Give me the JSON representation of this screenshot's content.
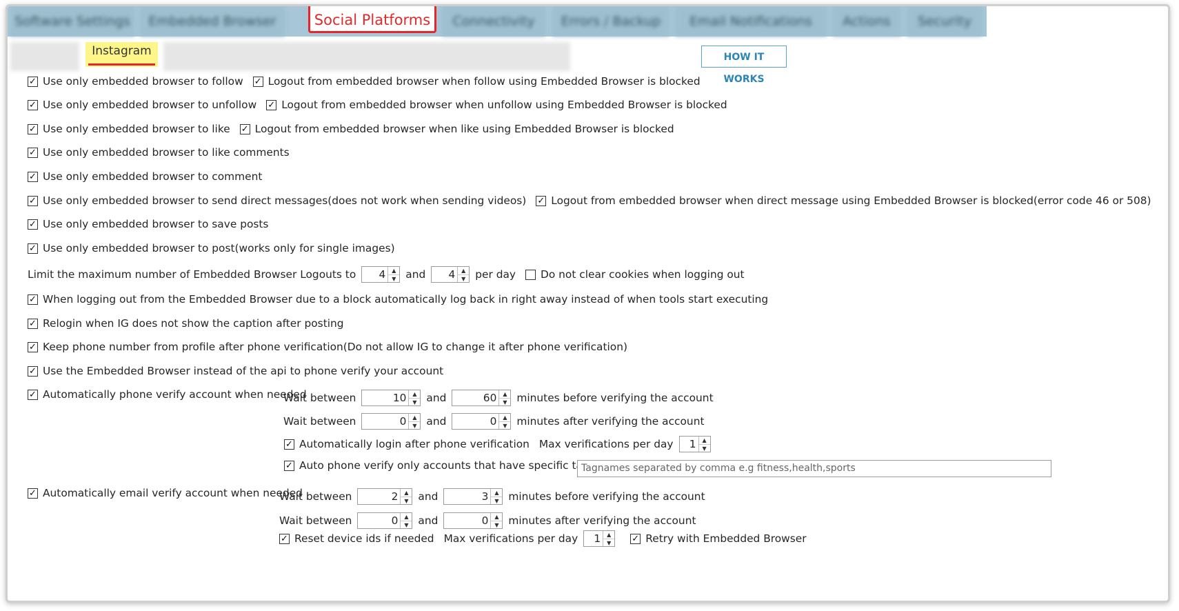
{
  "tabs": {
    "blurred": [
      "Software Settings",
      "Embedded Browser",
      "Connectivity",
      "Errors / Backup",
      "Email Notifications",
      "Actions",
      "Security"
    ],
    "active": "Social Platforms"
  },
  "subtabs": {
    "active": "Instagram"
  },
  "how_it_works": "HOW IT WORKS",
  "rows": {
    "follow": "Use only embedded browser to follow",
    "follow_logout": "Logout from embedded browser when follow using Embedded Browser is blocked",
    "unfollow": "Use only embedded browser to unfollow",
    "unfollow_logout": "Logout from embedded browser when unfollow using Embedded Browser is blocked",
    "like": "Use only embedded browser to like",
    "like_logout": "Logout from embedded browser when like using Embedded Browser is blocked",
    "like_comments": "Use only embedded browser to like comments",
    "comment": "Use only embedded browser to comment",
    "dm": "Use only embedded browser to send direct messages(does not work when sending videos)",
    "dm_logout": "Logout from embedded browser when direct message using Embedded Browser is blocked(error code 46 or 508)",
    "save": "Use only embedded browser to save posts",
    "post": "Use only embedded browser to post(works only for single images)",
    "limit_label": "Limit the maximum number of Embedded Browser Logouts to",
    "limit_min": "4",
    "limit_and": "and",
    "limit_max": "4",
    "limit_per_day": "per day",
    "no_clear_cookies": "Do not clear cookies when logging out",
    "relog": "When logging out from the Embedded Browser due to a block automatically log back in right away instead of when tools start executing",
    "relogin_caption": "Relogin when IG does not show the caption after posting",
    "keep_phone": "Keep phone number from profile after phone verification(Do not allow IG to change it after phone verification)",
    "eb_phone": "Use the Embedded Browser instead of the api to phone verify your account",
    "auto_phone": "Automatically phone verify account when needed",
    "wait_between": "Wait between",
    "and": "and",
    "before": "minutes before verifying the account",
    "after": "minutes after verifying the account",
    "phone_before_min": "10",
    "phone_before_max": "60",
    "phone_after_min": "0",
    "phone_after_max": "0",
    "auto_login": "Automatically login after phone verification",
    "max_ver": "Max verifications per day",
    "phone_max_ver": "1",
    "auto_tag": "Auto phone verify only accounts that have specific tag names",
    "tag_placeholder": "Tagnames separated by comma e.g fitness,health,sports",
    "auto_email": "Automatically email verify account when needed",
    "email_before_min": "2",
    "email_before_max": "3",
    "email_after_min": "0",
    "email_after_max": "0",
    "reset_ids": "Reset device ids if needed",
    "email_max_ver": "1",
    "retry_eb": "Retry with Embedded Browser"
  }
}
